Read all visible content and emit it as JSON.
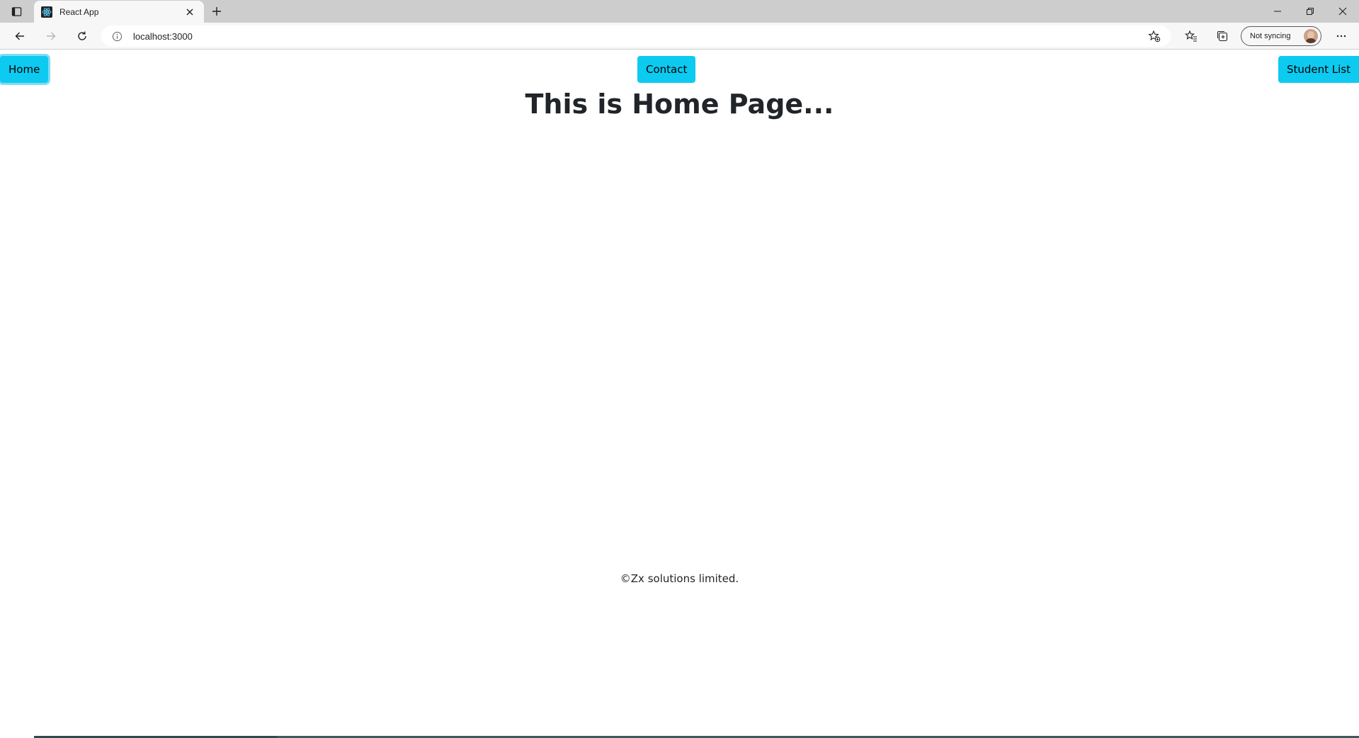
{
  "browser": {
    "tab": {
      "title": "React App",
      "favicon": "react-logo-icon"
    },
    "address": {
      "url": "localhost:3000"
    },
    "profile": {
      "label": "Not syncing"
    },
    "icons": [
      "tab-actions-icon",
      "close-tab-icon",
      "new-tab-icon",
      "minimize-icon",
      "restore-icon",
      "close-window-icon",
      "back-icon",
      "forward-icon",
      "refresh-icon",
      "site-info-icon",
      "add-favorite-icon",
      "favorites-icon",
      "collections-icon",
      "more-icon"
    ]
  },
  "nav": {
    "home_label": "Home",
    "contact_label": "Contact",
    "students_label": "Student List",
    "button_color": "#0dcaf0"
  },
  "main": {
    "heading": "This is Home Page..."
  },
  "footer": {
    "text": "©Zx solutions limited."
  }
}
